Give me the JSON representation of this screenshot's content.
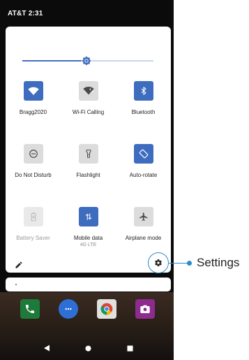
{
  "status_bar": {
    "carrier_time": "AT&T  2:31"
  },
  "brightness": {
    "level_percent": 49,
    "icon": "brightness-icon"
  },
  "tiles": [
    {
      "label": "Bragg2020",
      "icon": "wifi-icon",
      "state": "on"
    },
    {
      "label": "Wi-Fi Calling",
      "icon": "wifi-calling-icon",
      "state": "off"
    },
    {
      "label": "Bluetooth",
      "icon": "bluetooth-icon",
      "state": "on"
    },
    {
      "label": "Do Not Disturb",
      "icon": "do-not-disturb-icon",
      "state": "off"
    },
    {
      "label": "Flashlight",
      "icon": "flashlight-icon",
      "state": "off"
    },
    {
      "label": "Auto-rotate",
      "icon": "auto-rotate-icon",
      "state": "on"
    },
    {
      "label": "Battery Saver",
      "icon": "battery-saver-icon",
      "state": "disabled"
    },
    {
      "label": "Mobile data",
      "sublabel": "4G LTE",
      "icon": "mobile-data-icon",
      "state": "on"
    },
    {
      "label": "Airplane mode",
      "icon": "airplane-icon",
      "state": "off"
    }
  ],
  "panel_actions": {
    "edit_icon": "pencil-icon",
    "settings_icon": "gear-icon"
  },
  "callout": {
    "label": "Settings"
  },
  "dock": [
    {
      "icon": "phone-icon",
      "color": "#1e7a3a"
    },
    {
      "icon": "messages-icon",
      "color": "#2d6fd6"
    },
    {
      "icon": "chrome-icon",
      "color": "#e0e0e0"
    },
    {
      "icon": "camera-icon",
      "color": "#8e2b8f"
    }
  ],
  "colors": {
    "accent": "#3e6dbf",
    "callout": "#2b8ac9"
  }
}
